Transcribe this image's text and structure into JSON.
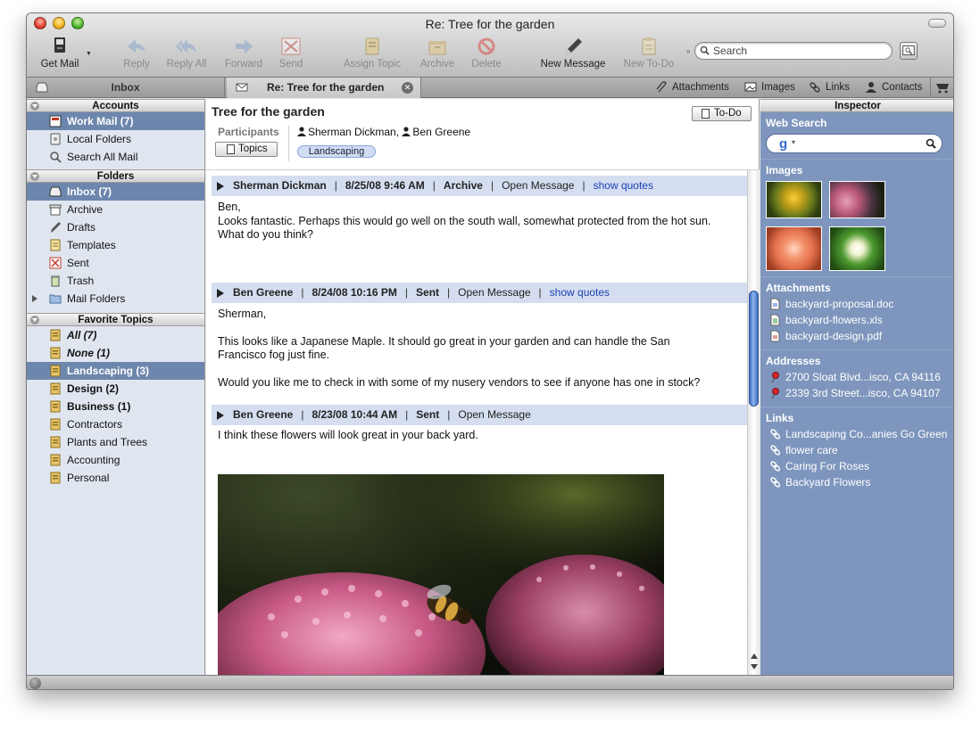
{
  "window": {
    "title": "Re: Tree for the garden"
  },
  "toolbar": {
    "get_mail": "Get Mail",
    "reply": "Reply",
    "reply_all": "Reply All",
    "forward": "Forward",
    "send": "Send",
    "assign_topic": "Assign Topic",
    "archive": "Archive",
    "delete": "Delete",
    "new_message": "New Message",
    "new_todo": "New To-Do",
    "search_placeholder": "Search"
  },
  "tabs": {
    "inbox": "Inbox",
    "active": "Re: Tree for the garden",
    "links": [
      "Attachments",
      "Images",
      "Links",
      "Contacts"
    ]
  },
  "sidebar": {
    "accounts_header": "Accounts",
    "accounts": [
      {
        "label": "Work Mail (7)",
        "icon": "mailbox-icon",
        "selected": true
      },
      {
        "label": "Local Folders",
        "icon": "local-folders-icon"
      },
      {
        "label": "Search All Mail",
        "icon": "search-icon"
      }
    ],
    "folders_header": "Folders",
    "folders": [
      {
        "label": "Inbox (7)",
        "icon": "inbox-icon",
        "selected": true
      },
      {
        "label": "Archive",
        "icon": "archive-icon"
      },
      {
        "label": "Drafts",
        "icon": "drafts-icon"
      },
      {
        "label": "Templates",
        "icon": "templates-icon"
      },
      {
        "label": "Sent",
        "icon": "sent-icon"
      },
      {
        "label": "Trash",
        "icon": "trash-icon"
      },
      {
        "label": "Mail Folders",
        "icon": "folder-icon"
      }
    ],
    "topics_header": "Favorite Topics",
    "topics": [
      {
        "label": "All (7)"
      },
      {
        "label": "None (1)"
      },
      {
        "label": "Landscaping (3)",
        "selected": true
      },
      {
        "label": "Design (2)"
      },
      {
        "label": "Business (1)"
      },
      {
        "label": "Contractors"
      },
      {
        "label": "Plants and Trees"
      },
      {
        "label": "Accounting"
      },
      {
        "label": "Personal"
      }
    ]
  },
  "conversation": {
    "title": "Tree for the garden",
    "todo_label": "To-Do",
    "participants_label": "Participants",
    "topics_button": "Topics",
    "participants": [
      "Sherman Dickman,",
      "Ben Greene"
    ],
    "topic_tag": "Landscaping",
    "messages": [
      {
        "sender": "Sherman Dickman",
        "date": "8/25/08 9:46 AM",
        "folder": "Archive",
        "open": "Open Message",
        "quotes": "show quotes",
        "body": [
          "Ben,",
          "Looks fantastic.  Perhaps this would go well on the south wall, somewhat protected from the hot sun.",
          "What do you think?"
        ]
      },
      {
        "sender": "Ben Greene",
        "date": "8/24/08 10:16 PM",
        "folder": "Sent",
        "open": "Open Message",
        "quotes": "show quotes",
        "body": [
          "Sherman,",
          "This looks like a Japanese Maple. It should go great in your garden and can handle the San",
          "Francisco fog just fine.",
          "Would you like me to check in with some of my nusery vendors to see if anyone has one in stock?"
        ]
      },
      {
        "sender": "Ben Greene",
        "date": "8/23/08 10:44 AM",
        "folder": "Sent",
        "open": "Open Message",
        "body": [
          "I think these flowers will look great in your back yard."
        ]
      }
    ]
  },
  "inspector": {
    "header": "Inspector",
    "web_search": "Web Search",
    "images_title": "Images",
    "attachments_title": "Attachments",
    "attachments": [
      "backyard-proposal.doc",
      "backyard-flowers.xls",
      "backyard-design.pdf"
    ],
    "addresses_title": "Addresses",
    "addresses": [
      "2700 Sloat Blvd...isco, CA 94116",
      "2339 3rd Street...isco, CA 94107"
    ],
    "links_title": "Links",
    "links": [
      "Landscaping Co...anies Go Green",
      "flower care",
      "Caring For Roses",
      "Backyard Flowers"
    ]
  },
  "colors": {
    "selection": "#6d86ad",
    "inspector_bg": "#7e96bd",
    "message_header": "#d4def0",
    "link": "#1a3fb5"
  }
}
